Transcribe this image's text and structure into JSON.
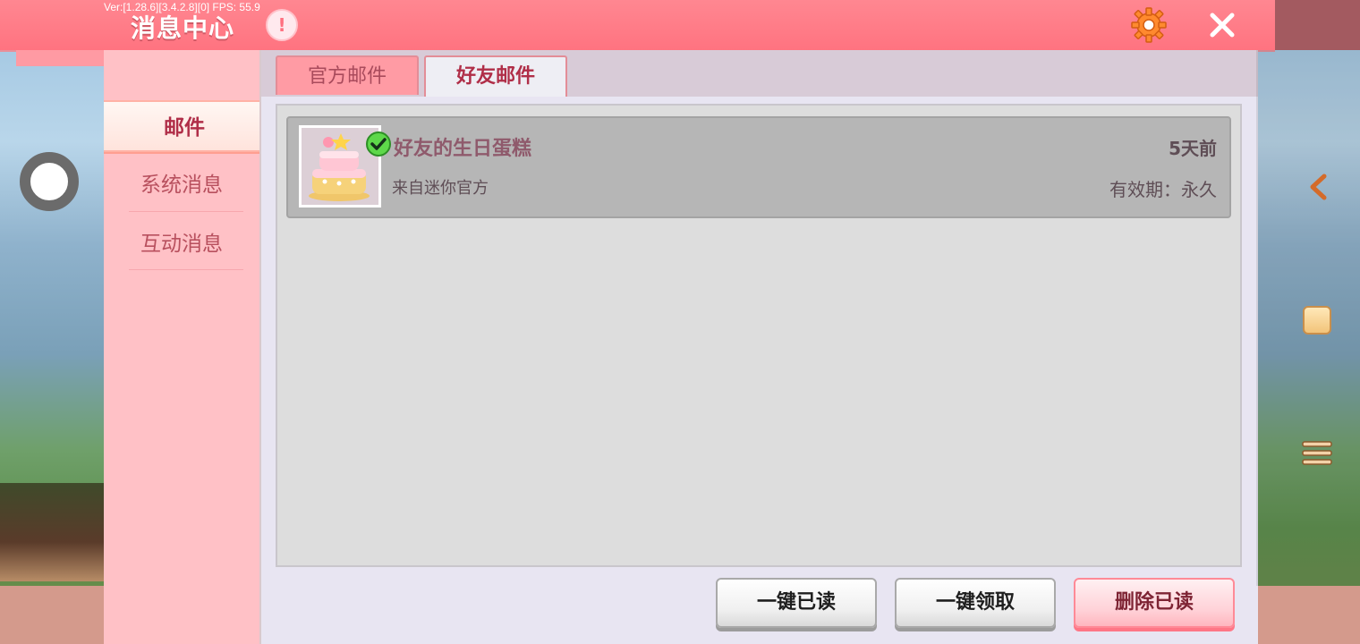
{
  "header": {
    "title": "消息中心",
    "version": "Ver:[1.28.6][3.4.2.8][0] FPS: 55.9",
    "alert_glyph": "!",
    "icons": [
      "gear-icon",
      "close-icon"
    ]
  },
  "sidebar": {
    "items": [
      {
        "label": "邮件",
        "active": true
      },
      {
        "label": "系统消息",
        "active": false
      },
      {
        "label": "互动消息",
        "active": false
      }
    ]
  },
  "tabs": [
    {
      "label": "官方邮件",
      "active": false
    },
    {
      "label": "好友邮件",
      "active": true
    }
  ],
  "mails": [
    {
      "title": "好友的生日蛋糕",
      "from": "来自迷你官方",
      "time": "5天前",
      "expiry": "有效期：永久",
      "thumbnail": "birthday-cake-icon",
      "claimed": true
    }
  ],
  "actions": {
    "read_all": "一键已读",
    "claim_all": "一键领取",
    "delete_read": "删除已读"
  },
  "colors": {
    "header": "#ff7f8a",
    "sidebar": "#ffc1c6",
    "accent_text": "#b02e48"
  }
}
